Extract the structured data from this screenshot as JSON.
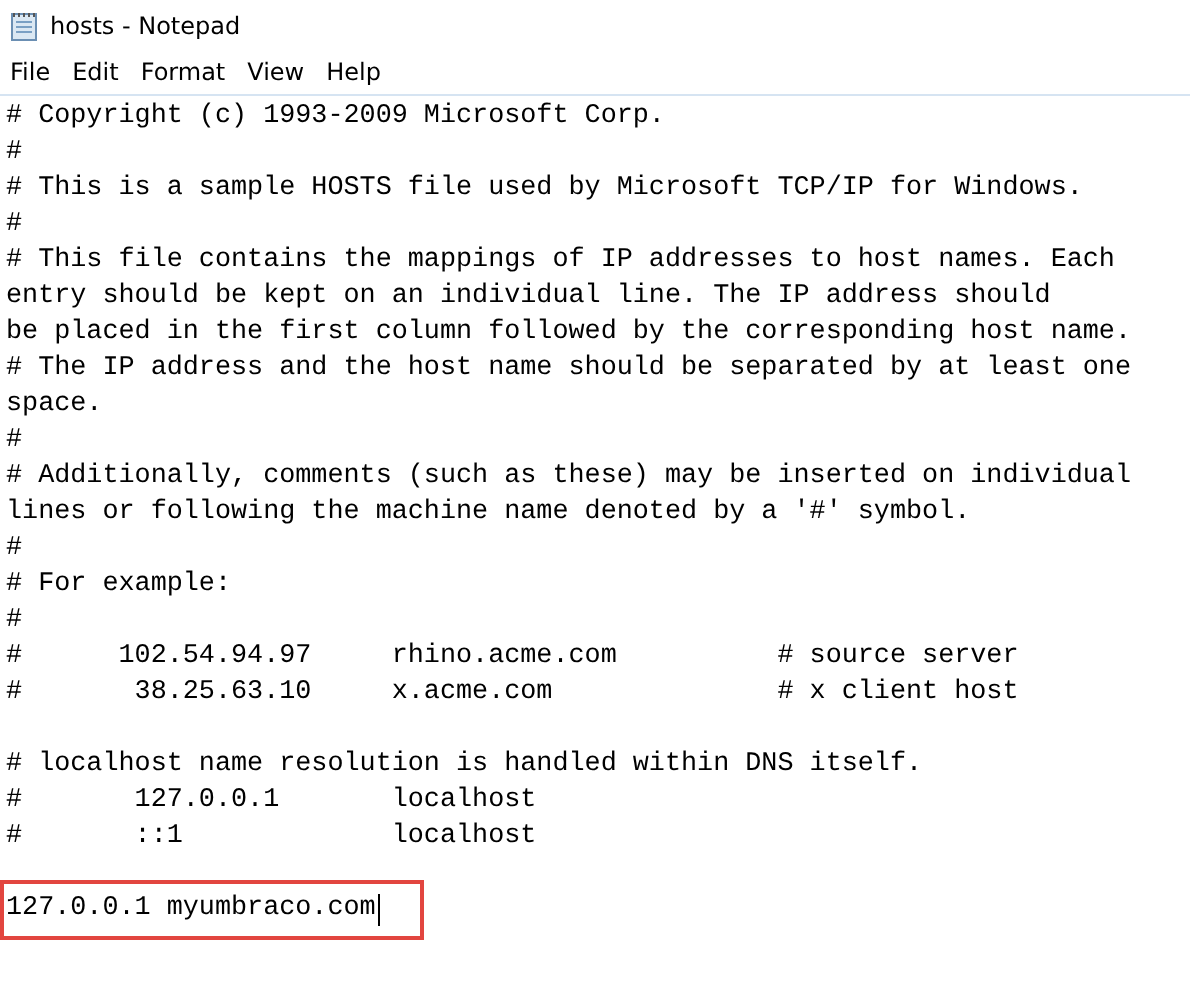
{
  "window": {
    "title": "hosts - Notepad"
  },
  "menu": [
    "File",
    "Edit",
    "Format",
    "View",
    "Help"
  ],
  "blocks": [
    {
      "highlighted": false,
      "caret": false,
      "lines": [
        "# Copyright (c) 1993-2009 Microsoft Corp.",
        "#",
        "# This is a sample HOSTS file used by Microsoft TCP/IP for Windows.",
        "#",
        "# This file contains the mappings of IP addresses to host names. Each",
        "entry should be kept on an individual line. The IP address should",
        "be placed in the first column followed by the corresponding host name.",
        "# The IP address and the host name should be separated by at least one",
        "space.",
        "#",
        "# Additionally, comments (such as these) may be inserted on individual",
        "lines or following the machine name denoted by a '#' symbol.",
        "#",
        "# For example:",
        "#",
        "#      102.54.94.97     rhino.acme.com          # source server",
        "#       38.25.63.10     x.acme.com              # x client host"
      ]
    },
    {
      "highlighted": false,
      "caret": false,
      "lines": [
        "# localhost name resolution is handled within DNS itself.",
        "#       127.0.0.1       localhost",
        "#       ::1             localhost"
      ]
    },
    {
      "highlighted": true,
      "caret": true,
      "lines": [
        "127.0.0.1 myumbraco.com"
      ]
    }
  ]
}
